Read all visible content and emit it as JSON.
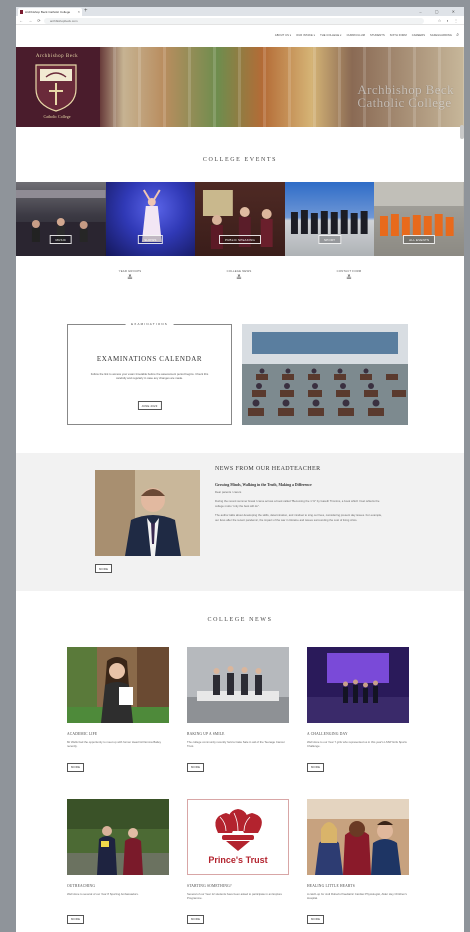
{
  "browser": {
    "tab_title": "Archbishop Beck Catholic College",
    "url": "archbishopbeck.com",
    "new_tab": "+",
    "window_controls": "– ▢ ✕"
  },
  "nav": {
    "items": [
      "ABOUT US",
      "OUR INTAKE",
      "THE COLLEGE",
      "CURRICULUM",
      "STUDENTS",
      "SIXTH FORM",
      "CAREERS",
      "SAFEGUARDING"
    ]
  },
  "hero": {
    "crest_top": "Archbishop Beck",
    "crest_bottom": "Catholic College",
    "name_line1": "Archbishop Beck",
    "name_line2": "Catholic College"
  },
  "events": {
    "title": "COLLEGE EVENTS",
    "items": [
      {
        "label": "MUSIC"
      },
      {
        "label": "SHOWS"
      },
      {
        "label": "PUBLIC SPEAKING"
      },
      {
        "label": "SPORT"
      },
      {
        "label": "ALL EVENTS"
      }
    ]
  },
  "quick_links": [
    "YEAR GROUPS",
    "COLLEGE NEWS",
    "CONTACT FORM"
  ],
  "exams": {
    "tag": "EXAMINATIONS",
    "title": "EXAMINATIONS CALENDAR",
    "text": "Follow the link to access your exam timetable before the assessment period begins. Check this carefully and regularly in case any changes are made.",
    "button": "JUNE 2023"
  },
  "headteacher": {
    "title": "NEWS FROM OUR HEADTEACHER",
    "subtitle": "Growing Minds, Walking in the Truth, Making a Difference",
    "greeting": "Dear parents / carers",
    "p1": "During the recent summer break I came across a book called \"Becoming the 1 %\" by Gareth Timmins, a book which I feel reflects the college motto \"only the best will do\".",
    "p2": "The author talks about developing the skills, determination, and mindset to sing our lives, considering present day issues. For example, our lives after the recent pandemic, the impact of the war in Ukraine and issues surrounding the cost of living crisis.",
    "button": "MORE"
  },
  "news": {
    "title": "COLLEGE NEWS",
    "cards": [
      {
        "heading": "ACADEMIC LIFE",
        "text": "Mr Wells had the opportunity to meet up with former Head Girl Emma Bailey recently.",
        "button": "MORE"
      },
      {
        "heading": "BAKING UP A SMILE",
        "text": "The college community recently held a Cake Sale in aid of the Teenage Cancer Trust.",
        "button": "MORE"
      },
      {
        "heading": "A CHALLENGING DAY",
        "text": "Well done to our Year 7 girls who represented us in this year's LSSP Girls Sports Challenge.",
        "button": "MORE"
      },
      {
        "heading": "OUTREACHING",
        "text": "Well done to several of our Year 8 Sporting Ambassadors.",
        "button": "MORE"
      },
      {
        "heading": "STARTING SOMETHING?",
        "text": "Several of our Year 12 students have been asked to participate in an Explore Programme.",
        "button": "MORE"
      },
      {
        "heading": "HEALING LITTLE HEARTS",
        "text": "A catch-up for Jodi Roberts Paediatric Cardiac Physiologist, Alder Hey Children's Hospital.",
        "button": "MORE"
      }
    ],
    "logo_text": "Prince's Trust"
  }
}
